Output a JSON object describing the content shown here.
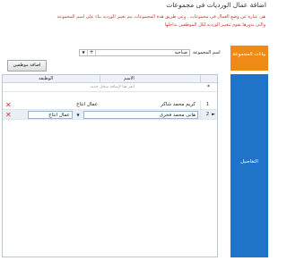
{
  "page": {
    "title": "اضافة عمال الورديات فى مجموعات",
    "description_1": "هى عبارة عن وضع العمال فى مجموعات . وعن طريق هذة المجموعات يتم تغيير الوردية بناء على اسم المجموعة",
    "description_2": "والتى بدورها تقوم بتغيير الورديه لكل الموظفين بداخلها"
  },
  "sidebar": {
    "group_tab": "بيانات المجموعة",
    "details_tab": "التفاصيل"
  },
  "form": {
    "group_label": "اسم المجموعة",
    "group_value": "صباحية",
    "dropdown_icon": "chevron-down-icon",
    "add_icon": "plus-icon"
  },
  "toolbar": {
    "add_employees": "اضافة موظفين"
  },
  "grid": {
    "columns": {
      "name": "الاسم",
      "job": "الوظيفه"
    },
    "new_row_hint": "انقر هنا لإضافة سجل جديد",
    "new_row_marker": "*",
    "rows": [
      {
        "num": "1",
        "name": "كريم محمد شاكر",
        "job": "عمال انتاج",
        "current": false
      },
      {
        "num": "2",
        "name": "هانى محمد فخرى",
        "job": "عمال انتاج",
        "current": true
      }
    ],
    "delete_icon": "close-icon",
    "delete_color": "#d0342c",
    "current_row_icon": "triangle-right-icon"
  },
  "colors": {
    "orange_tab": "#ef8a17",
    "blue_tab": "#1f74c9",
    "description_text": "#c0392b"
  }
}
